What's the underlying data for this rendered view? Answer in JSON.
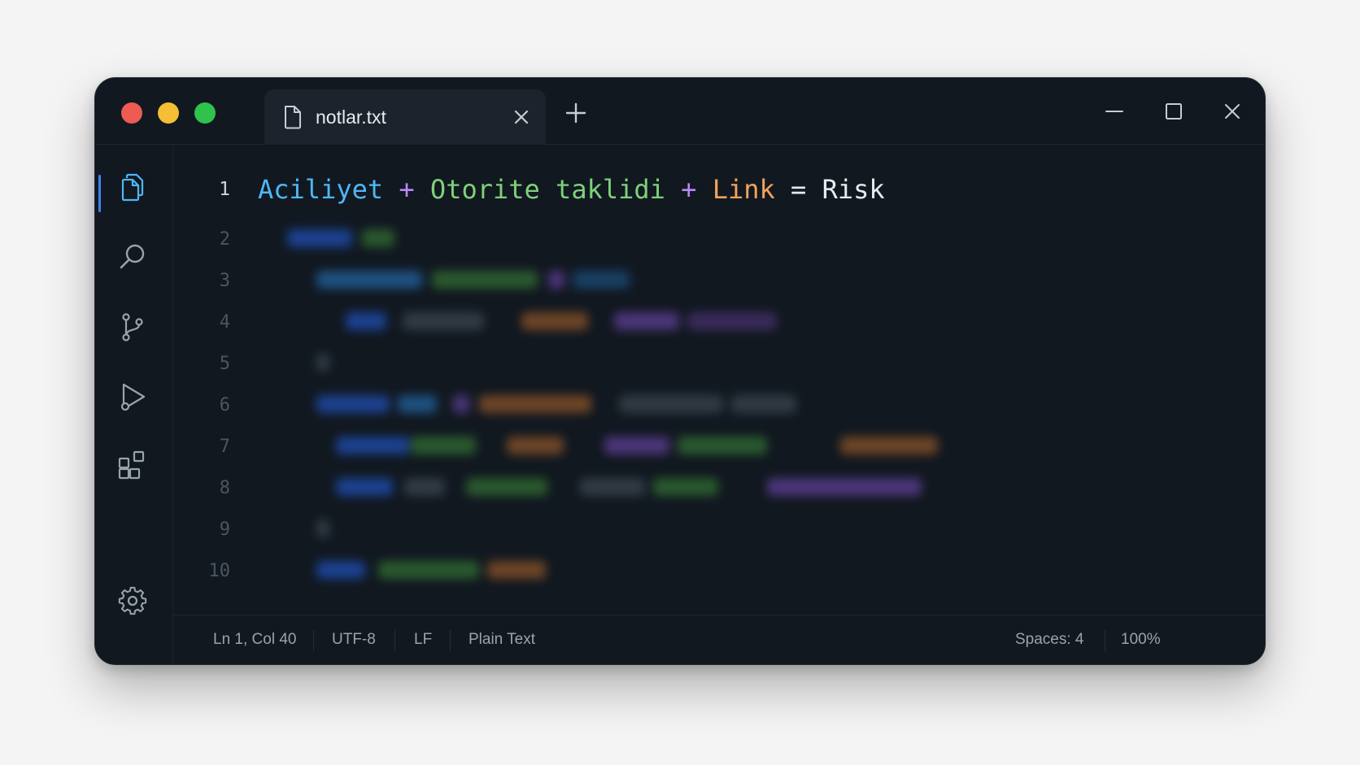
{
  "window": {
    "controls": {
      "close": "traffic-light-red",
      "minimize": "traffic-light-yellow",
      "zoom": "traffic-light-green"
    }
  },
  "tab": {
    "title": "notlar.txt",
    "icon": "file-icon",
    "close_icon": "close-icon"
  },
  "new_tab_icon": "plus-icon",
  "window_controls": [
    "minimize-icon",
    "maximize-icon",
    "close-icon"
  ],
  "activity_bar": {
    "items": [
      "files-icon",
      "search-icon",
      "source-control-icon",
      "run-icon",
      "extensions-icon"
    ],
    "active": "files-icon",
    "bottom": "gear-icon"
  },
  "editor": {
    "line_numbers": [
      "1",
      "2",
      "3",
      "4",
      "5",
      "6",
      "7",
      "8",
      "9",
      "10"
    ],
    "line1": {
      "t1": "Aciliyet",
      "op1": "+",
      "t2": "Otorite taklidi",
      "op2": "+",
      "t3": "Link",
      "op3": "=",
      "t4": "Risk"
    },
    "blurred_lines_note": ""
  },
  "statusbar": {
    "position": "Ln 1, Col 40",
    "encoding": "UTF-8",
    "eol": "LF",
    "language": "Plain Text",
    "indent": "Spaces: 4",
    "zoom": "100%"
  },
  "colors": {
    "accent": "#3b82f6",
    "token_blue": "#4fb6f6",
    "token_purple": "#b889f4",
    "token_green": "#7fd07a",
    "token_orange": "#f2a35a"
  }
}
